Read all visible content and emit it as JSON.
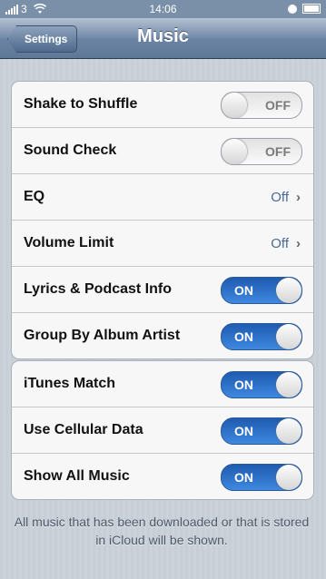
{
  "status_bar": {
    "carrier": "3",
    "time": "14:06"
  },
  "nav": {
    "back_label": "Settings",
    "title": "Music"
  },
  "group1": [
    {
      "label": "Shake to Shuffle",
      "type": "switch",
      "state": "OFF"
    },
    {
      "label": "Sound Check",
      "type": "switch",
      "state": "OFF"
    },
    {
      "label": "EQ",
      "type": "detail",
      "value": "Off"
    },
    {
      "label": "Volume Limit",
      "type": "detail",
      "value": "Off"
    },
    {
      "label": "Lyrics & Podcast Info",
      "type": "switch",
      "state": "ON"
    },
    {
      "label": "Group By Album Artist",
      "type": "switch",
      "state": "ON"
    }
  ],
  "group2": [
    {
      "label": "iTunes Match",
      "type": "switch",
      "state": "ON"
    },
    {
      "label": "Use Cellular Data",
      "type": "switch",
      "state": "ON"
    },
    {
      "label": "Show All Music",
      "type": "switch",
      "state": "ON"
    }
  ],
  "footer": "All music that has been downloaded or that is stored in iCloud will be shown.",
  "icons": {
    "detail": "chevron-right-icon",
    "signal": "signal-icon",
    "wifi": "wifi-icon",
    "lock": "orientation-lock-icon",
    "battery": "battery-icon"
  },
  "colors": {
    "switch_on": "#2f72cf",
    "detail_value": "#4a6a98"
  }
}
